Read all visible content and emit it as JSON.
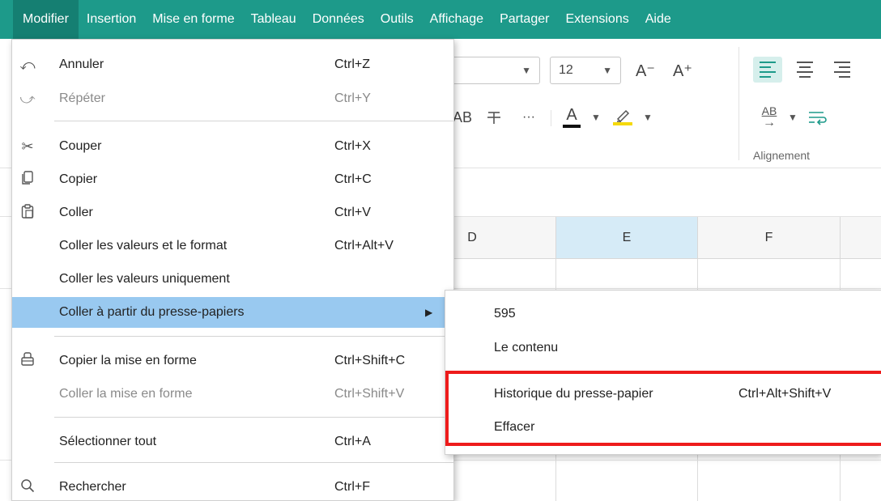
{
  "menubar": {
    "items": [
      "Modifier",
      "Insertion",
      "Mise en forme",
      "Tableau",
      "Données",
      "Outils",
      "Affichage",
      "Partager",
      "Extensions",
      "Aide"
    ]
  },
  "ribbon": {
    "font_size": "12",
    "grow_font": "A⁻",
    "shrink_font": "A⁺",
    "text_fx_label": "AB",
    "more_label": "···",
    "font_color_glyph": "A",
    "wrap_label": "AB",
    "alignment_group_label": "Alignement",
    "font_color_underline": "#111111",
    "highlight_color": "#f5d90a"
  },
  "grid": {
    "columns": [
      "D",
      "E",
      "F"
    ]
  },
  "menu": {
    "items": [
      {
        "icon": "undo-icon",
        "glyph": "⤺",
        "label": "Annuler",
        "shortcut": "Ctrl+Z",
        "disabled": false
      },
      {
        "icon": "redo-icon",
        "glyph": "⤻",
        "label": "Répéter",
        "shortcut": "Ctrl+Y",
        "disabled": true
      },
      {
        "icon": "cut-icon",
        "glyph": "✂",
        "label": "Couper",
        "shortcut": "Ctrl+X",
        "disabled": false
      },
      {
        "icon": "copy-icon",
        "glyph": "⧉",
        "label": "Copier",
        "shortcut": "Ctrl+C",
        "disabled": false
      },
      {
        "icon": "paste-icon",
        "glyph": "📋",
        "label": "Coller",
        "shortcut": "Ctrl+V",
        "disabled": false
      },
      {
        "icon": "",
        "glyph": "",
        "label": "Coller les valeurs et le format",
        "shortcut": "Ctrl+Alt+V",
        "disabled": false
      },
      {
        "icon": "",
        "glyph": "",
        "label": "Coller les valeurs uniquement",
        "shortcut": "",
        "disabled": false
      },
      {
        "icon": "",
        "glyph": "",
        "label": "Coller à partir du presse-papiers",
        "shortcut": "",
        "disabled": false,
        "submenu": true
      },
      {
        "icon": "format-painter-icon",
        "glyph": "🖌",
        "label": "Copier la mise en forme",
        "shortcut": "Ctrl+Shift+C",
        "disabled": false
      },
      {
        "icon": "",
        "glyph": "",
        "label": "Coller la mise en forme",
        "shortcut": "Ctrl+Shift+V",
        "disabled": true
      },
      {
        "icon": "",
        "glyph": "",
        "label": "Sélectionner tout",
        "shortcut": "Ctrl+A",
        "disabled": false
      },
      {
        "icon": "search-icon",
        "glyph": "⌕",
        "label": "Rechercher",
        "shortcut": "Ctrl+F",
        "disabled": false
      }
    ]
  },
  "submenu": {
    "items": [
      {
        "label": "595",
        "shortcut": ""
      },
      {
        "label": "Le contenu",
        "shortcut": ""
      },
      {
        "label": "Historique du presse-papier",
        "shortcut": "Ctrl+Alt+Shift+V"
      },
      {
        "label": "Effacer",
        "shortcut": ""
      }
    ]
  },
  "colors": {
    "menubar_bg": "#1d9a8a",
    "hover_bg": "#99c9f0",
    "highlight_border": "#ee1b1b",
    "selected_column_bg": "#d6ebf7"
  }
}
